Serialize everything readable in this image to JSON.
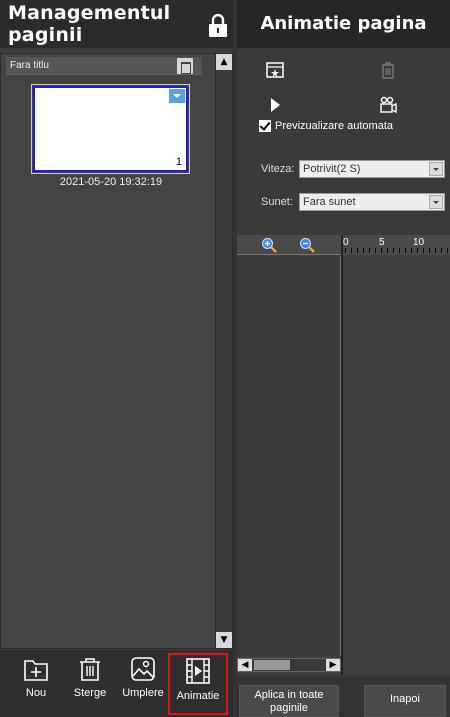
{
  "left_panel": {
    "title": "Managementul paginii",
    "group_label": "Fara titlu",
    "page": {
      "number": "1",
      "timestamp": "2021-05-20 19:32:19"
    },
    "toolbar": [
      {
        "label": "Nou",
        "icon": "new-page-icon"
      },
      {
        "label": "Sterge",
        "icon": "trash-icon"
      },
      {
        "label": "Umplere",
        "icon": "image-fill-icon"
      },
      {
        "label": "Animatie",
        "icon": "animation-film-icon",
        "active": true
      }
    ]
  },
  "right_panel": {
    "title": "Animatie pagina",
    "autopreview_label": "Previzualizare automata",
    "autopreview_checked": true,
    "speed": {
      "label": "Viteza:",
      "value": "Potrivit(2 S)"
    },
    "sound": {
      "label": "Sunet:",
      "value": "Fara sunet"
    },
    "ruler": {
      "ticks": [
        "0",
        "5",
        "10"
      ]
    },
    "buttons": {
      "apply_all": "Aplica in toate paginile",
      "back": "Inapoi"
    }
  },
  "colors": {
    "highlight": "#e01414",
    "selection": "#2020c8",
    "accent": "#5aa0d8"
  }
}
